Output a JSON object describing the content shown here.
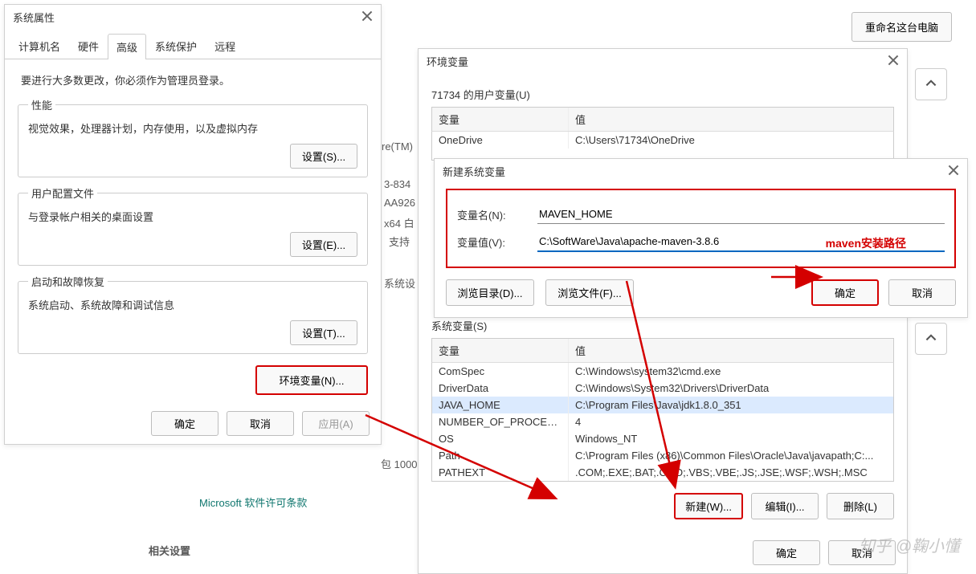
{
  "top_right_button": "重命名这台电脑",
  "sysprops": {
    "title": "系统属性",
    "tabs": [
      "计算机名",
      "硬件",
      "高级",
      "系统保护",
      "远程"
    ],
    "active_tab_index": 2,
    "admin_note": "要进行大多数更改，你必须作为管理员登录。",
    "perf": {
      "title": "性能",
      "desc": "视觉效果，处理器计划，内存使用，以及虚拟内存",
      "btn": "设置(S)..."
    },
    "profile": {
      "title": "用户配置文件",
      "desc": "与登录帐户相关的桌面设置",
      "btn": "设置(E)..."
    },
    "startup": {
      "title": "启动和故障恢复",
      "desc": "系统启动、系统故障和调试信息",
      "btn": "设置(T)..."
    },
    "env_btn": "环境变量(N)...",
    "ok": "确定",
    "cancel": "取消",
    "apply": "应用(A)"
  },
  "bg": {
    "t1": "re(TM)",
    "t2": "3-834",
    "t3": "AA926",
    "t4": "x64 白",
    "t5": "支持",
    "t6": "系统设",
    "t7": "包 1000",
    "t8": "Microsoft 软件许可条款",
    "t9": "相关设置"
  },
  "envdlg": {
    "title": "环境变量",
    "user_label": "71734 的用户变量(U)",
    "col_var": "变量",
    "col_val": "值",
    "user_rows": [
      {
        "var": "OneDrive",
        "val": "C:\\Users\\71734\\OneDrive"
      }
    ],
    "sys_label": "系统变量(S)",
    "sys_rows": [
      {
        "var": "ComSpec",
        "val": "C:\\Windows\\system32\\cmd.exe"
      },
      {
        "var": "DriverData",
        "val": "C:\\Windows\\System32\\Drivers\\DriverData"
      },
      {
        "var": "JAVA_HOME",
        "val": "C:\\Program Files\\Java\\jdk1.8.0_351"
      },
      {
        "var": "NUMBER_OF_PROCESSORS",
        "val": "4"
      },
      {
        "var": "OS",
        "val": "Windows_NT"
      },
      {
        "var": "Path",
        "val": "C:\\Program Files (x86)\\Common Files\\Oracle\\Java\\javapath;C:..."
      },
      {
        "var": "PATHEXT",
        "val": ".COM;.EXE;.BAT;.CMD;.VBS;.VBE;.JS;.JSE;.WSF;.WSH;.MSC"
      }
    ],
    "new_btn": "新建(W)...",
    "edit_btn": "编辑(I)...",
    "del_btn": "删除(L)",
    "ok": "确定",
    "cancel": "取消"
  },
  "newvar": {
    "title": "新建系统变量",
    "name_label": "变量名(N):",
    "name_value": "MAVEN_HOME",
    "val_label": "变量值(V):",
    "val_value": "C:\\SoftWare\\Java\\apache-maven-3.8.6",
    "note": "maven安装路径",
    "browse_dir": "浏览目录(D)...",
    "browse_file": "浏览文件(F)...",
    "ok": "确定",
    "cancel": "取消"
  },
  "watermark": "知乎 @鞠小懂"
}
